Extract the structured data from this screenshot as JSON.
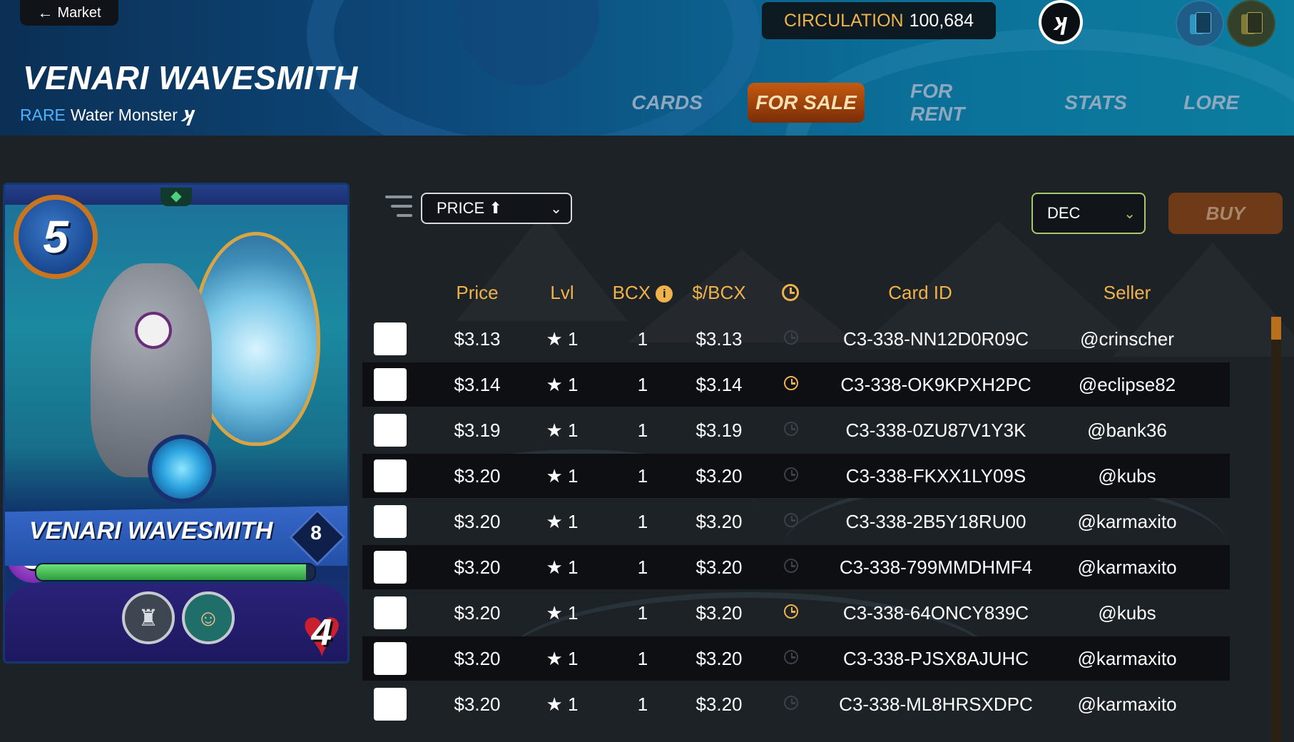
{
  "header": {
    "back_label": "Market",
    "title": "VENARI WAVESMITH",
    "rarity": "RARE",
    "type_label": "Water Monster",
    "circulation_label": "CIRCULATION",
    "circulation_value": "100,684",
    "tabs": [
      {
        "label": "CARDS",
        "active": false
      },
      {
        "label": "FOR SALE",
        "active": true
      },
      {
        "label": "FOR RENT",
        "active": false
      },
      {
        "label": "STATS",
        "active": false
      },
      {
        "label": "LORE",
        "active": false
      }
    ]
  },
  "card": {
    "name": "VENARI WAVESMITH",
    "mana": "5",
    "magic": "3",
    "speed": "4",
    "health": "4",
    "level": "8",
    "xp_fraction": 0.97
  },
  "filters": {
    "sort_value": "PRICE ⬆",
    "currency_value": "DEC",
    "buy_label": "BUY"
  },
  "table": {
    "headers": {
      "price": "Price",
      "lvl": "Lvl",
      "bcx": "BCX",
      "per_bcx": "$/BCX",
      "card_id": "Card ID",
      "seller": "Seller"
    },
    "rows": [
      {
        "price": "$3.13",
        "lvl": "★ 1",
        "bcx": "1",
        "per_bcx": "$3.13",
        "recent": false,
        "card_id": "C3-338-NN12D0R09C",
        "seller": "@crinscher"
      },
      {
        "price": "$3.14",
        "lvl": "★ 1",
        "bcx": "1",
        "per_bcx": "$3.14",
        "recent": true,
        "card_id": "C3-338-OK9KPXH2PC",
        "seller": "@eclipse82"
      },
      {
        "price": "$3.19",
        "lvl": "★ 1",
        "bcx": "1",
        "per_bcx": "$3.19",
        "recent": false,
        "card_id": "C3-338-0ZU87V1Y3K",
        "seller": "@bank36"
      },
      {
        "price": "$3.20",
        "lvl": "★ 1",
        "bcx": "1",
        "per_bcx": "$3.20",
        "recent": false,
        "card_id": "C3-338-FKXX1LY09S",
        "seller": "@kubs"
      },
      {
        "price": "$3.20",
        "lvl": "★ 1",
        "bcx": "1",
        "per_bcx": "$3.20",
        "recent": false,
        "card_id": "C3-338-2B5Y18RU00",
        "seller": "@karmaxito"
      },
      {
        "price": "$3.20",
        "lvl": "★ 1",
        "bcx": "1",
        "per_bcx": "$3.20",
        "recent": false,
        "card_id": "C3-338-799MMDHMF4",
        "seller": "@karmaxito"
      },
      {
        "price": "$3.20",
        "lvl": "★ 1",
        "bcx": "1",
        "per_bcx": "$3.20",
        "recent": true,
        "card_id": "C3-338-64ONCY839C",
        "seller": "@kubs"
      },
      {
        "price": "$3.20",
        "lvl": "★ 1",
        "bcx": "1",
        "per_bcx": "$3.20",
        "recent": false,
        "card_id": "C3-338-PJSX8AJUHC",
        "seller": "@karmaxito"
      },
      {
        "price": "$3.20",
        "lvl": "★ 1",
        "bcx": "1",
        "per_bcx": "$3.20",
        "recent": false,
        "card_id": "C3-338-ML8HRSXDPC",
        "seller": "@karmaxito"
      }
    ]
  },
  "colors": {
    "accent": "#f0b24a",
    "rarity": "#4fb2ff",
    "active_tab": "#c55a10"
  }
}
